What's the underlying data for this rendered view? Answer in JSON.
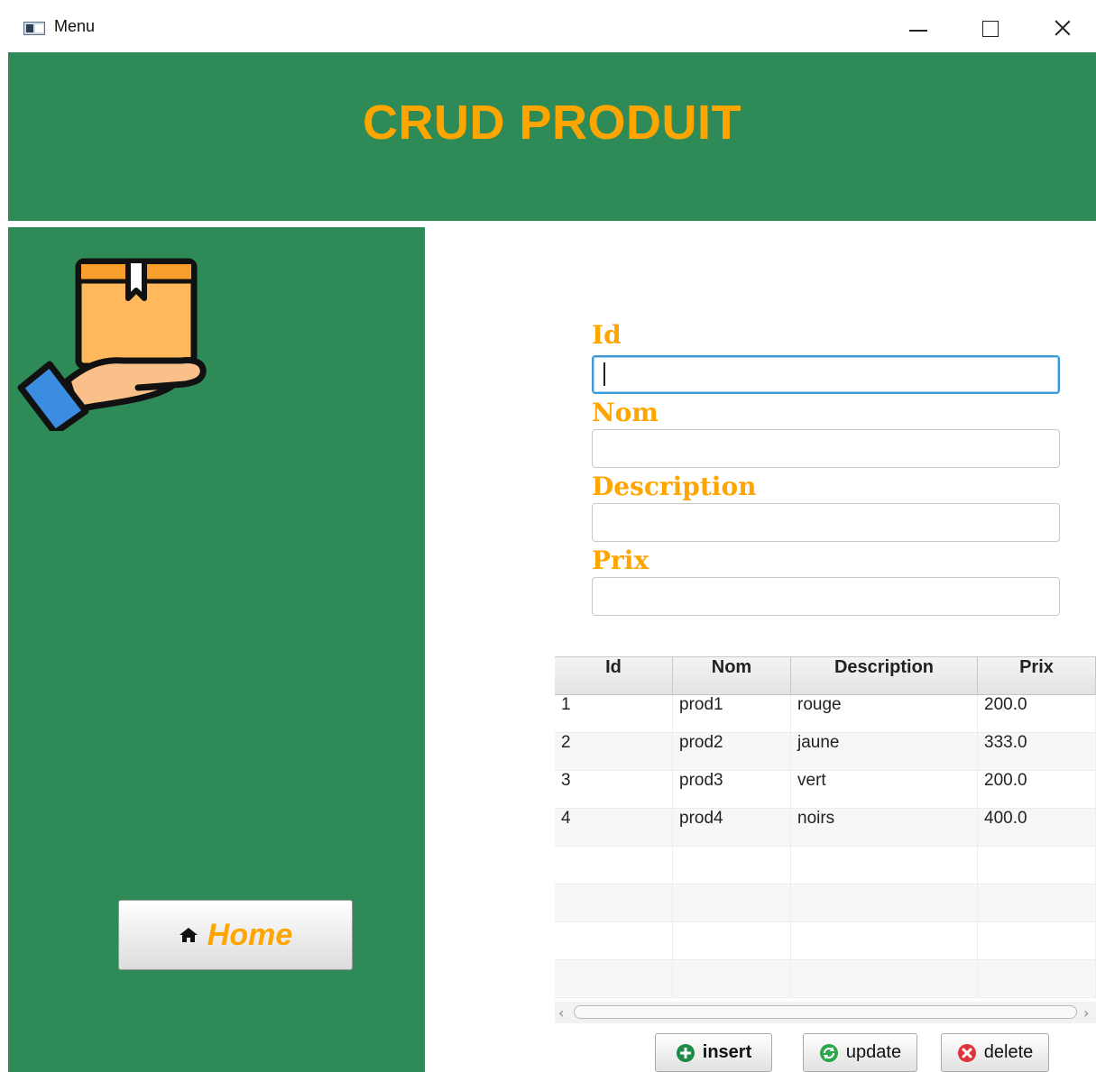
{
  "window": {
    "title": "Menu",
    "minimize_icon": "minimize-icon",
    "maximize_icon": "maximize-icon",
    "close_icon": "close-icon"
  },
  "header": {
    "title": "CRUD PRODUIT"
  },
  "colors": {
    "green": "#2e8b57",
    "accent": "#ffa500",
    "focus": "#3a9bd8"
  },
  "sidebar": {
    "logo_icon": "hand-holding-box-icon",
    "home_button": {
      "label": "Home",
      "icon": "home-icon"
    }
  },
  "form": {
    "fields": [
      {
        "label": "Id",
        "value": ""
      },
      {
        "label": "Nom",
        "value": ""
      },
      {
        "label": "Description",
        "value": ""
      },
      {
        "label": "Prix",
        "value": ""
      }
    ]
  },
  "table": {
    "columns": [
      "Id",
      "Nom",
      "Description",
      "Prix"
    ],
    "rows": [
      [
        "1",
        "prod1",
        "rouge",
        "200.0"
      ],
      [
        "2",
        "prod2",
        "jaune",
        "333.0"
      ],
      [
        "3",
        "prod3",
        "vert",
        "200.0"
      ],
      [
        "4",
        "prod4",
        "noirs",
        "400.0"
      ]
    ]
  },
  "actions": {
    "insert": {
      "label": "insert",
      "icon": "plus-circle-icon"
    },
    "update": {
      "label": "update",
      "icon": "refresh-icon"
    },
    "delete": {
      "label": "delete",
      "icon": "x-circle-icon"
    }
  }
}
